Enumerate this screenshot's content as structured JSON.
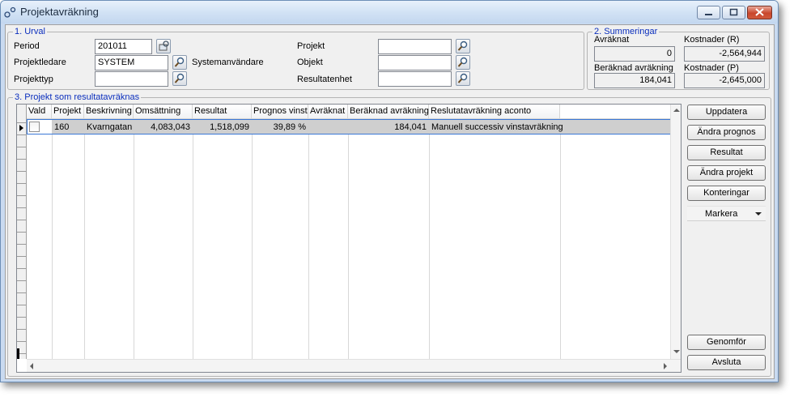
{
  "window": {
    "title": "Projektavräkning"
  },
  "urval": {
    "legend": "1. Urval",
    "period_label": "Period",
    "period_value": "201011",
    "projektledare_label": "Projektledare",
    "projektledare_value": "SYSTEM",
    "systemanvandare_label": "Systemanvändare",
    "projekttyp_label": "Projekttyp",
    "projekttyp_value": "",
    "projekt_label": "Projekt",
    "projekt_value": "",
    "objekt_label": "Objekt",
    "objekt_value": "",
    "resultatenhet_label": "Resultatenhet",
    "resultatenhet_value": ""
  },
  "summeringar": {
    "legend": "2. Summeringar",
    "avraknat_label": "Avräknat",
    "avraknat_value": "0",
    "kostnader_r_label": "Kostnader (R)",
    "kostnader_r_value": "-2,564,944",
    "beraknad_label": "Beräknad avräkning",
    "beraknad_value": "184,041",
    "kostnader_p_label": "Kostnader (P)",
    "kostnader_p_value": "-2,645,000"
  },
  "projekt": {
    "legend": "3. Projekt som resultatavräknas",
    "columns": [
      "Vald",
      "Projekt",
      "Beskrivning",
      "Omsättning",
      "Resultat",
      "Prognos vinst",
      "Avräknat",
      "Beräknad avräkning",
      "Reslutatavräkning aconto"
    ],
    "rows": [
      {
        "vald": "",
        "projekt": "160",
        "beskrivning": "Kvarngatan",
        "omsattning": "4,083,043",
        "resultat": "1,518,099",
        "prognos_vinst": "39,89 %",
        "avraknat": "",
        "beraknad_avrakning": "184,041",
        "aconto": "Manuell successiv vinstavräkning"
      }
    ]
  },
  "buttons": {
    "uppdatera": "Uppdatera",
    "andra_prognos": "Ändra prognos",
    "resultat": "Resultat",
    "andra_projekt": "Ändra projekt",
    "konteringar": "Konteringar",
    "markera": "Markera",
    "genomfor": "Genomför",
    "avsluta": "Avsluta"
  },
  "colors": {
    "legend": "#0a2ebd",
    "selection_border": "#3b78d6",
    "selection_fill": "#cfcfcf"
  },
  "icons": [
    "app-icon",
    "minimize-icon",
    "maximize-icon",
    "close-icon",
    "lookup-icon",
    "chevron-down-icon",
    "scroll-up-icon",
    "scroll-down-icon",
    "scroll-left-icon",
    "scroll-right-icon"
  ]
}
